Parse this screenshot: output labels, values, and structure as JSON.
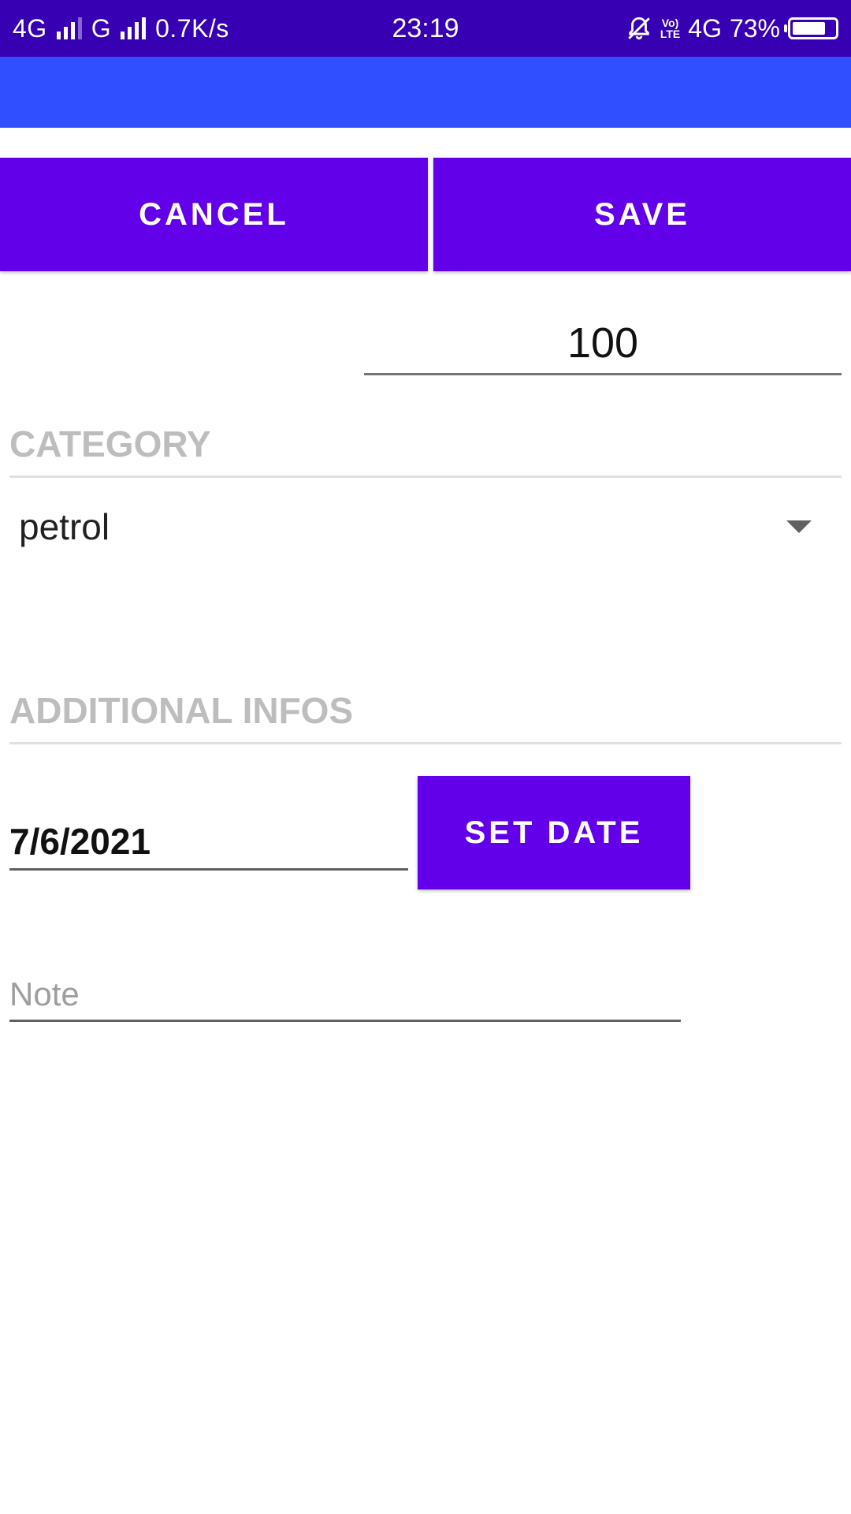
{
  "status_bar": {
    "network_left": "4G",
    "network_mid": "G",
    "speed": "0.7K/s",
    "time": "23:19",
    "volte_top": "Vo)",
    "volte_bottom": "LTE",
    "network_right": "4G",
    "battery": "73%"
  },
  "actions": {
    "cancel_label": "CANCEL",
    "save_label": "SAVE"
  },
  "form": {
    "amount": "100",
    "category_header": "CATEGORY",
    "category_value": "petrol",
    "additional_header": "ADDITIONAL INFOS",
    "date_value": "7/6/2021",
    "set_date_label": "SET DATE",
    "note_placeholder": "Note"
  },
  "colors": {
    "status_bar": "#3700B3",
    "app_bar": "#304FFE",
    "button": "#6200EA",
    "section_header_text": "#BDBDBD"
  }
}
